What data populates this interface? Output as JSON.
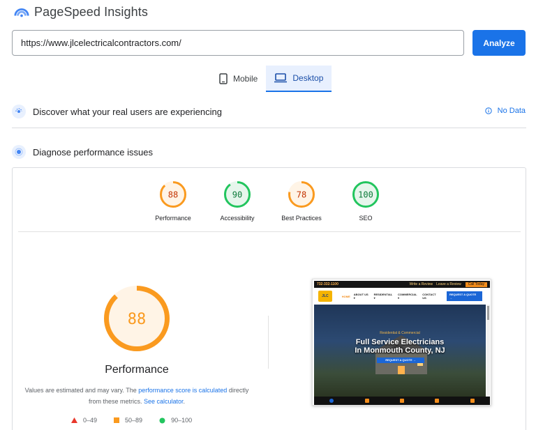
{
  "app": {
    "title": "PageSpeed Insights"
  },
  "search": {
    "url": "https://www.jlcelectricalcontractors.com/",
    "analyze_label": "Analyze"
  },
  "device_tabs": [
    {
      "label": "Mobile",
      "icon": "phone-icon",
      "active": false
    },
    {
      "label": "Desktop",
      "icon": "desktop-icon",
      "active": true
    }
  ],
  "real_users": {
    "title": "Discover what your real users are experiencing",
    "status": "No Data"
  },
  "diagnose": {
    "title": "Diagnose performance issues"
  },
  "scores": [
    {
      "label": "Performance",
      "score": "88",
      "value": 88,
      "color": "#fa9a1f",
      "fill": "#fff4e6",
      "text": "#c33300"
    },
    {
      "label": "Accessibility",
      "score": "90",
      "value": 90,
      "color": "#22c55e",
      "fill": "#e6f6ec",
      "text": "#0d7a3a"
    },
    {
      "label": "Best Practices",
      "score": "78",
      "value": 78,
      "color": "#fa9a1f",
      "fill": "#fff4e6",
      "text": "#c33300"
    },
    {
      "label": "SEO",
      "score": "100",
      "value": 100,
      "color": "#22c55e",
      "fill": "#e6f6ec",
      "text": "#0d7a3a"
    }
  ],
  "main_score": {
    "score": "88",
    "value": 88,
    "label": "Performance",
    "note_text_1": "Values are estimated and may vary. The ",
    "note_link_1": "performance score is calculated",
    "note_text_2": " directly from these metrics. ",
    "note_link_2": "See calculator",
    "note_text_3": "."
  },
  "legend": [
    {
      "range": "0–49",
      "shape": "triangle",
      "color": "#e8372b"
    },
    {
      "range": "50–89",
      "shape": "square",
      "color": "#fa9a1f"
    },
    {
      "range": "90–100",
      "shape": "circle",
      "color": "#22c55e"
    }
  ],
  "site_preview": {
    "phone": "732-332-1100",
    "topbar_links": [
      "Write a Review",
      "Leave a Review"
    ],
    "topbar_button": "Call Today",
    "logo": "JLC",
    "nav": [
      "HOME",
      "ABOUT US ▾",
      "RESIDENTIAL ▾",
      "COMMERCIAL ▾",
      "CONTACT US"
    ],
    "nav_button": "REQUEST A QUOTE →",
    "eyebrow": "Residential & Commercial",
    "headline_1": "Full Service Electricians",
    "headline_2": "In Monmouth County, NJ",
    "cta": "REQUEST A QUOTE →"
  },
  "colors": {
    "accent": "#1a73e8",
    "pass": "#22c55e",
    "average": "#fa9a1f",
    "fail": "#e8372b"
  }
}
